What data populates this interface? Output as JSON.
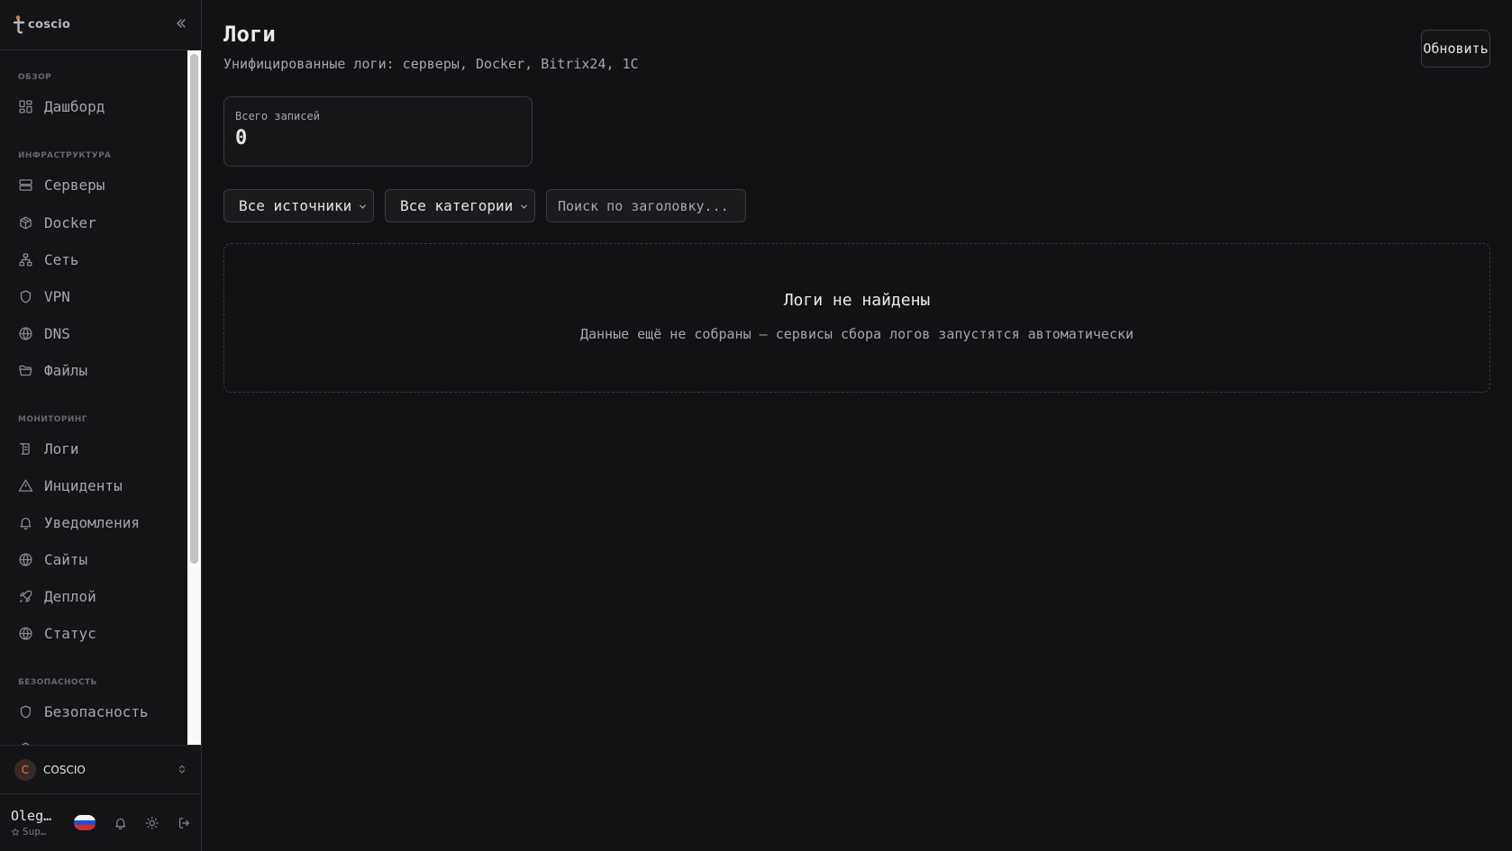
{
  "app": {
    "brand": "coscio"
  },
  "sidebar": {
    "sections": [
      {
        "label": "ОБЗОР",
        "items": [
          {
            "label": "Дашборд",
            "icon": "dashboard-icon"
          }
        ]
      },
      {
        "label": "ИНФРАСТРУКТУРА",
        "items": [
          {
            "label": "Серверы",
            "icon": "server-icon"
          },
          {
            "label": "Docker",
            "icon": "box-icon"
          },
          {
            "label": "Сеть",
            "icon": "network-icon"
          },
          {
            "label": "VPN",
            "icon": "shield-icon"
          },
          {
            "label": "DNS",
            "icon": "globe-icon"
          },
          {
            "label": "Файлы",
            "icon": "folder-icon"
          }
        ]
      },
      {
        "label": "МОНИТОРИНГ",
        "items": [
          {
            "label": "Логи",
            "icon": "logs-icon"
          },
          {
            "label": "Инциденты",
            "icon": "warning-icon"
          },
          {
            "label": "Уведомления",
            "icon": "bell-icon"
          },
          {
            "label": "Сайты",
            "icon": "globe-icon"
          },
          {
            "label": "Деплой",
            "icon": "rocket-icon"
          },
          {
            "label": "Статус",
            "icon": "globe-icon"
          }
        ]
      },
      {
        "label": "БЕЗОПАСНОСТЬ",
        "items": [
          {
            "label": "Безопасность",
            "icon": "shield-icon"
          }
        ]
      }
    ]
  },
  "org": {
    "initial": "C",
    "name": "COSCIO"
  },
  "user": {
    "name": "Oleg…",
    "role": "Sup…"
  },
  "page": {
    "title": "Логи",
    "subtitle": "Унифицированные логи: серверы, Docker, Bitrix24, 1С",
    "refresh_label": "Обновить"
  },
  "stats": {
    "total_label": "Всего записей",
    "total_value": "0"
  },
  "filters": {
    "source_selected": "Все источники",
    "category_selected": "Все категории",
    "search_placeholder": "Поиск по заголовку..."
  },
  "empty_state": {
    "title": "Логи не найдены",
    "description": "Данные ещё не собраны — сервисы сбора логов запустятся автоматически"
  },
  "colors": {
    "background": "#121214",
    "sidebar": "#141416",
    "border": "#2c2c30",
    "text": "#e4e4e7",
    "muted": "#a5a5ad",
    "org_accent": "#e07f4f"
  }
}
